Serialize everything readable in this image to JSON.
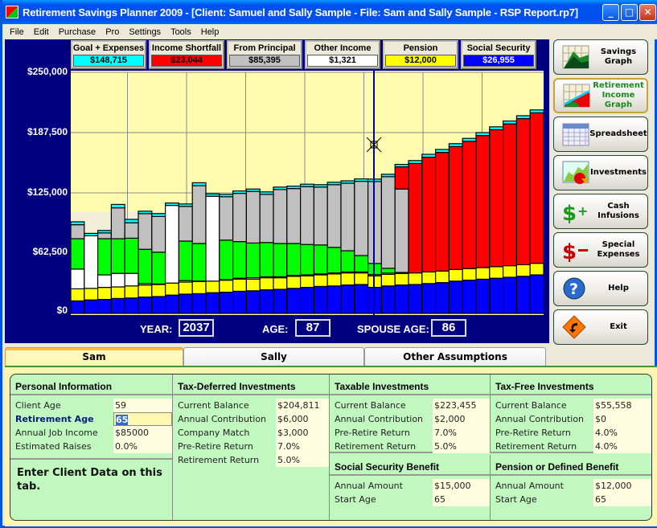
{
  "window": {
    "title": "Retirement Savings Planner 2009 - [Client: Samuel and Sally Sample  - File: Sam and Sally Sample - RSP Report.rp7]",
    "controls": [
      "minimize",
      "maximize",
      "close"
    ]
  },
  "menu": [
    "File",
    "Edit",
    "Purchase",
    "Pro",
    "Settings",
    "Tools",
    "Help"
  ],
  "legend": [
    {
      "label": "Goal + Expenses",
      "value": "$148,715",
      "color": "#00ffff",
      "text_color": "#000000"
    },
    {
      "label": "Income Shortfall",
      "value": "$23,044",
      "color": "#ff0000",
      "text_color": "#000000"
    },
    {
      "label": "From Principal",
      "value": "$85,395",
      "color": "#c0c0c0",
      "text_color": "#000000"
    },
    {
      "label": "Other Income",
      "value": "$1,321",
      "color": "#ffffff",
      "text_color": "#000000"
    },
    {
      "label": "Pension",
      "value": "$12,000",
      "color": "#ffff00",
      "text_color": "#000000"
    },
    {
      "label": "Social Security",
      "value": "$26,955",
      "color": "#0000ff",
      "text_color": "#ffffff"
    }
  ],
  "readout": {
    "year_label": "YEAR:",
    "year": "2037",
    "age_label": "AGE:",
    "age": "87",
    "spouse_age_label": "SPOUSE AGE:",
    "spouse_age": "86"
  },
  "side_buttons": [
    {
      "label": "Savings Graph",
      "icon": "savings-graph-icon",
      "active": false
    },
    {
      "label": "Retirement Income Graph",
      "icon": "retirement-income-graph-icon",
      "active": true
    },
    {
      "label": "Spreadsheet",
      "icon": "spreadsheet-icon",
      "active": false
    },
    {
      "label": "Investments",
      "icon": "investments-icon",
      "active": false
    },
    {
      "label": "Cash Infusions",
      "icon": "cash-infusions-icon",
      "active": false
    },
    {
      "label": "Special Expenses",
      "icon": "special-expenses-icon",
      "active": false
    },
    {
      "label": "Help",
      "icon": "help-icon",
      "active": false
    },
    {
      "label": "Exit",
      "icon": "exit-icon",
      "active": false
    }
  ],
  "tabs": [
    {
      "label": "Sam",
      "active": true
    },
    {
      "label": "Sally",
      "active": false
    },
    {
      "label": "Other Assumptions",
      "active": false
    }
  ],
  "sections": {
    "personal": {
      "title": "Personal Information",
      "rows": [
        {
          "label": "Client Age",
          "value": "59"
        },
        {
          "label": "Retirement Age",
          "value": "65",
          "selected": true
        },
        {
          "label": "Annual Job Income",
          "value": "$85000"
        },
        {
          "label": "Estimated Raises",
          "value": "0.0%"
        }
      ],
      "note": "Enter Client Data on this tab."
    },
    "tax_deferred": {
      "title": "Tax-Deferred Investments",
      "rows": [
        {
          "label": "Current Balance",
          "value": "$204,811"
        },
        {
          "label": "Annual Contribution",
          "value": "$6,000"
        },
        {
          "label": "Company Match",
          "value": "$3,000"
        },
        {
          "label": "Pre-Retire Return",
          "value": "7.0%"
        },
        {
          "label": "Retirement Return",
          "value": "5.0%"
        }
      ]
    },
    "taxable": {
      "title": "Taxable Investments",
      "rows": [
        {
          "label": "Current Balance",
          "value": "$223,455"
        },
        {
          "label": "Annual Contribution",
          "value": "$2,000"
        },
        {
          "label": "Pre-Retire Return",
          "value": "7.0%"
        },
        {
          "label": "Retirement Return",
          "value": "5.0%"
        }
      ]
    },
    "tax_free": {
      "title": "Tax-Free Investments",
      "rows": [
        {
          "label": "Current Balance",
          "value": "$55,558"
        },
        {
          "label": "Annual Contribution",
          "value": "$0"
        },
        {
          "label": "Pre-Retire Return",
          "value": "4.0%"
        },
        {
          "label": "Retirement Return",
          "value": "4.0%"
        }
      ]
    },
    "social_security": {
      "title": "Social Security Benefit",
      "rows": [
        {
          "label": "Annual Amount",
          "value": "$15,000"
        },
        {
          "label": "Start Age",
          "value": "65"
        }
      ]
    },
    "pension": {
      "title": "Pension or Defined Benefit",
      "rows": [
        {
          "label": "Annual Amount",
          "value": "$12,000"
        },
        {
          "label": "Start Age",
          "value": "65"
        }
      ]
    }
  },
  "chart_data": {
    "type": "bar",
    "stacked": true,
    "title": "Retirement Income Graph",
    "ylabel": "",
    "xlabel": "",
    "ylim": [
      0,
      250000
    ],
    "yticks": [
      "$0",
      "$62,500",
      "$125,000",
      "$187,500",
      "$250,000"
    ],
    "ytick_values": [
      0,
      62500,
      125000,
      187500,
      250000
    ],
    "grid": true,
    "legend_position": "top",
    "selected_index": 22,
    "selected_year": 2037,
    "series": [
      {
        "name": "Social Security",
        "color": "#0000ff",
        "values": [
          13000,
          14000,
          14500,
          15500,
          16000,
          17000,
          17500,
          19000,
          20000,
          20500,
          21500,
          22000,
          23000,
          23500,
          24500,
          25000,
          26000,
          27000,
          28000,
          28500,
          29500,
          30000,
          27000,
          28500,
          29500,
          30000,
          31000,
          32000,
          33500,
          34500,
          35500,
          36500,
          37500,
          38500,
          40000
        ]
      },
      {
        "name": "Pension",
        "color": "#ffff00",
        "values": [
          12500,
          12000,
          12500,
          12000,
          12500,
          12500,
          12500,
          12500,
          12500,
          12500,
          12000,
          12500,
          12500,
          12000,
          12500,
          12000,
          12500,
          12000,
          12000,
          12500,
          12500,
          12000,
          12000,
          12000,
          12000,
          12000,
          12000,
          12000,
          12000,
          12000,
          12000,
          12000,
          12000,
          12000,
          12000
        ]
      },
      {
        "name": "Other Income",
        "color": "#ffffff",
        "values": [
          20500,
          54500,
          13000,
          14000,
          13000,
          1500,
          500,
          80500,
          1500,
          500,
          88000,
          500,
          1000,
          1500,
          1000,
          1000,
          1000,
          1000,
          1000,
          1000,
          1000,
          1000,
          1300,
          1300,
          1000,
          0,
          0,
          0,
          0,
          0,
          0,
          0,
          0,
          0,
          0
        ]
      },
      {
        "name": "Job Income",
        "color": "#00ff00",
        "values": [
          31500,
          0,
          37500,
          36000,
          36500,
          35500,
          33000,
          0,
          41000,
          39000,
          0,
          41000,
          38000,
          36000,
          35500,
          34500,
          33000,
          31500,
          30000,
          26500,
          22000,
          17000,
          11500,
          5000,
          0,
          0,
          0,
          0,
          0,
          0,
          0,
          0,
          0,
          0,
          0
        ]
      },
      {
        "name": "From Principal",
        "color": "#c0c0c0",
        "values": [
          14500,
          0,
          6000,
          32000,
          16000,
          37000,
          37000,
          0,
          36000,
          60000,
          0,
          45000,
          50000,
          53500,
          50000,
          56000,
          57000,
          60000,
          60000,
          65000,
          70000,
          77000,
          85000,
          95000,
          86500,
          0,
          0,
          0,
          0,
          0,
          0,
          0,
          0,
          0,
          0
        ]
      },
      {
        "name": "Income Shortfall",
        "color": "#ff0000",
        "values": [
          0,
          0,
          0,
          0,
          0,
          0,
          0,
          0,
          0,
          0,
          0,
          0,
          0,
          0,
          0,
          0,
          0,
          0,
          0,
          0,
          0,
          0,
          0,
          0,
          23000,
          113500,
          119000,
          123000,
          127500,
          132000,
          137000,
          142000,
          147000,
          151500,
          156000
        ]
      },
      {
        "name": "Goal + Expenses (cap)",
        "color": "#00ffff",
        "values": [
          3000,
          2500,
          2500,
          3500,
          3500,
          2500,
          3000,
          2500,
          2500,
          3000,
          2500,
          2500,
          2500,
          2500,
          2500,
          2500,
          2500,
          2500,
          2500,
          2500,
          2500,
          2500,
          2500,
          2500,
          2500,
          3000,
          3000,
          3000,
          3000,
          3000,
          3000,
          3000,
          3000,
          3000,
          3000
        ]
      }
    ]
  }
}
